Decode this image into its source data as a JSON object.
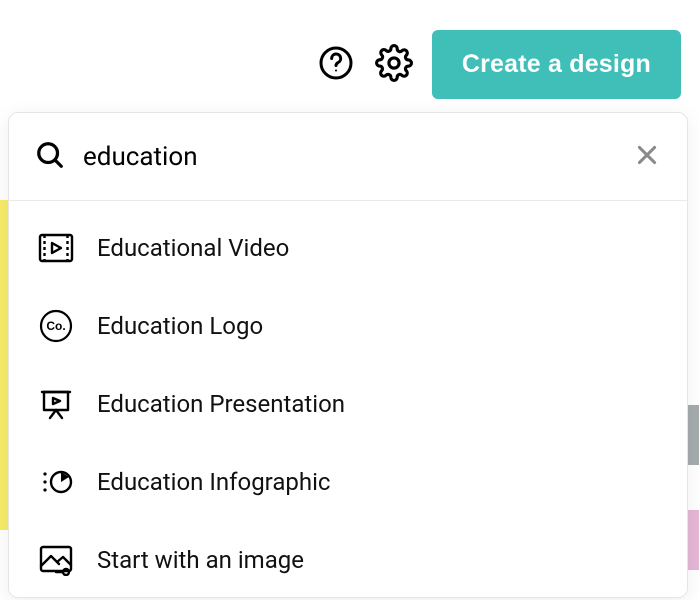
{
  "toolbar": {
    "create_label": "Create a design"
  },
  "search": {
    "value": "education",
    "placeholder": "Search"
  },
  "suggestions": [
    {
      "icon": "video-play-icon",
      "label": "Educational Video"
    },
    {
      "icon": "logo-co-icon",
      "label": "Education Logo"
    },
    {
      "icon": "presentation-icon",
      "label": "Education Presentation"
    },
    {
      "icon": "infographic-icon",
      "label": "Education Infographic"
    },
    {
      "icon": "image-icon",
      "label": "Start with an image"
    }
  ],
  "colors": {
    "accent": "#3fbfb8"
  }
}
